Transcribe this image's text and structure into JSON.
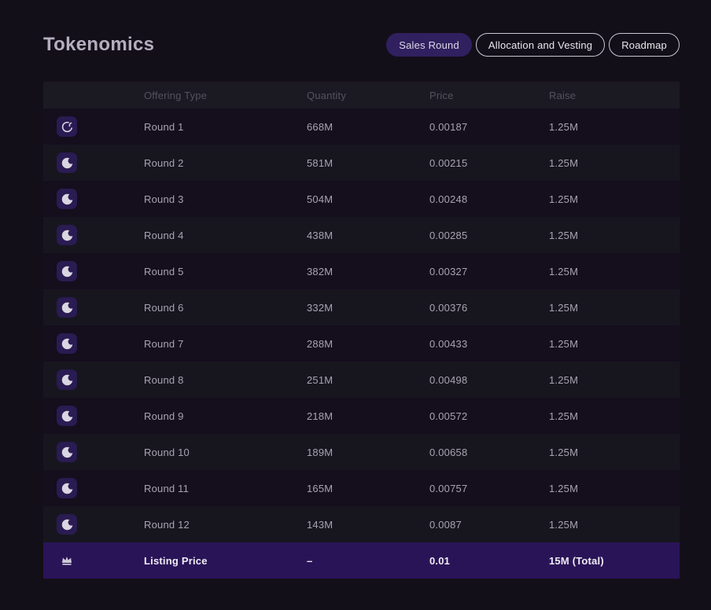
{
  "page": {
    "title": "Tokenomics"
  },
  "tabs": [
    {
      "label": "Sales Round",
      "active": true
    },
    {
      "label": "Allocation and Vesting",
      "active": false
    },
    {
      "label": "Roadmap",
      "active": false
    }
  ],
  "table": {
    "columns": [
      "Offering Type",
      "Quantity",
      "Price",
      "Raise"
    ],
    "rows": [
      {
        "icon": "moon-outline-icon",
        "offering": "Round 1",
        "quantity": "668M",
        "price": "0.00187",
        "raise": "1.25M",
        "highlight": false
      },
      {
        "icon": "moon-icon",
        "offering": "Round 2",
        "quantity": "581M",
        "price": "0.00215",
        "raise": "1.25M",
        "highlight": false
      },
      {
        "icon": "moon-icon",
        "offering": "Round 3",
        "quantity": "504M",
        "price": "0.00248",
        "raise": "1.25M",
        "highlight": false
      },
      {
        "icon": "moon-icon",
        "offering": "Round 4",
        "quantity": "438M",
        "price": "0.00285",
        "raise": "1.25M",
        "highlight": false
      },
      {
        "icon": "moon-icon",
        "offering": "Round 5",
        "quantity": "382M",
        "price": "0.00327",
        "raise": "1.25M",
        "highlight": false
      },
      {
        "icon": "moon-icon",
        "offering": "Round 6",
        "quantity": "332M",
        "price": "0.00376",
        "raise": "1.25M",
        "highlight": false
      },
      {
        "icon": "moon-icon",
        "offering": "Round 7",
        "quantity": "288M",
        "price": "0.00433",
        "raise": "1.25M",
        "highlight": false
      },
      {
        "icon": "moon-icon",
        "offering": "Round 8",
        "quantity": "251M",
        "price": "0.00498",
        "raise": "1.25M",
        "highlight": false
      },
      {
        "icon": "moon-icon",
        "offering": "Round 9",
        "quantity": "218M",
        "price": "0.00572",
        "raise": "1.25M",
        "highlight": false
      },
      {
        "icon": "moon-icon",
        "offering": "Round 10",
        "quantity": "189M",
        "price": "0.00658",
        "raise": "1.25M",
        "highlight": false
      },
      {
        "icon": "moon-icon",
        "offering": "Round 11",
        "quantity": "165M",
        "price": "0.00757",
        "raise": "1.25M",
        "highlight": false
      },
      {
        "icon": "moon-icon",
        "offering": "Round 12",
        "quantity": "143M",
        "price": "0.0087",
        "raise": "1.25M",
        "highlight": false
      },
      {
        "icon": "crown-icon",
        "offering": "Listing Price",
        "quantity": "–",
        "price": "0.01",
        "raise": "15M (Total)",
        "highlight": true
      }
    ]
  },
  "colors": {
    "page_bg": "#130f19",
    "active_tab": "#31205f",
    "header_row": "#1b1a23",
    "row_odd": "#150e1d",
    "row_even": "#17161f",
    "listing_row": "#2a1458",
    "icon_tile": "#2a1b52"
  }
}
